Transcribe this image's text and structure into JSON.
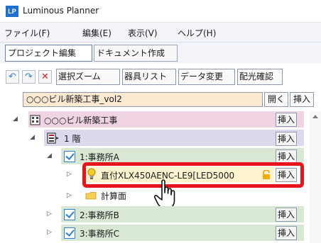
{
  "window": {
    "app_icon_text": "LP",
    "title": "Luminous Planner"
  },
  "menu": [
    "ファイル(F)",
    "編集(E)",
    "表示(V)",
    "ヘルプ(H)"
  ],
  "tabs": [
    {
      "label": "プロジェクト編集",
      "active": true
    },
    {
      "label": "ドキュメント作成",
      "active": false
    }
  ],
  "toolbar": {
    "undo_glyph": "↶",
    "redo_glyph": "↷",
    "delete_glyph": "✕",
    "buttons": [
      "選択ズーム",
      "器具リスト",
      "データ変更",
      "配光確認"
    ]
  },
  "project": {
    "name": "○○○ビル新築工事_vol2",
    "open_label": "開く",
    "insert_label": "挿入"
  },
  "tree": {
    "building": {
      "label": "○○○ビル新築工事",
      "expander": "◢",
      "insert": "挿入"
    },
    "floor": {
      "label": "1 階",
      "expander": "◢",
      "insert": "挿入"
    },
    "room_a": {
      "label": "1:事務所A",
      "expander": "◢",
      "insert": "挿入"
    },
    "luminaire": {
      "label": "直付XLX450AENC-LE9[LED5000",
      "expander": "▷",
      "insert": "挿入"
    },
    "calc_plane": {
      "label": "計算面",
      "expander": "▷"
    },
    "room_b": {
      "label": "2:事務所B",
      "expander": "▷",
      "insert": "挿入"
    },
    "room_c": {
      "label": "3:事務所C",
      "expander": "▷",
      "insert": "挿入"
    }
  },
  "colors": {
    "building_row": "#f0d4e4",
    "floor_row": "#dcd9ee",
    "room_row": "#d8e8d4",
    "luminaire_row": "#fff4cf",
    "highlight": "#e8141c",
    "accent": "#2f7fd6"
  }
}
